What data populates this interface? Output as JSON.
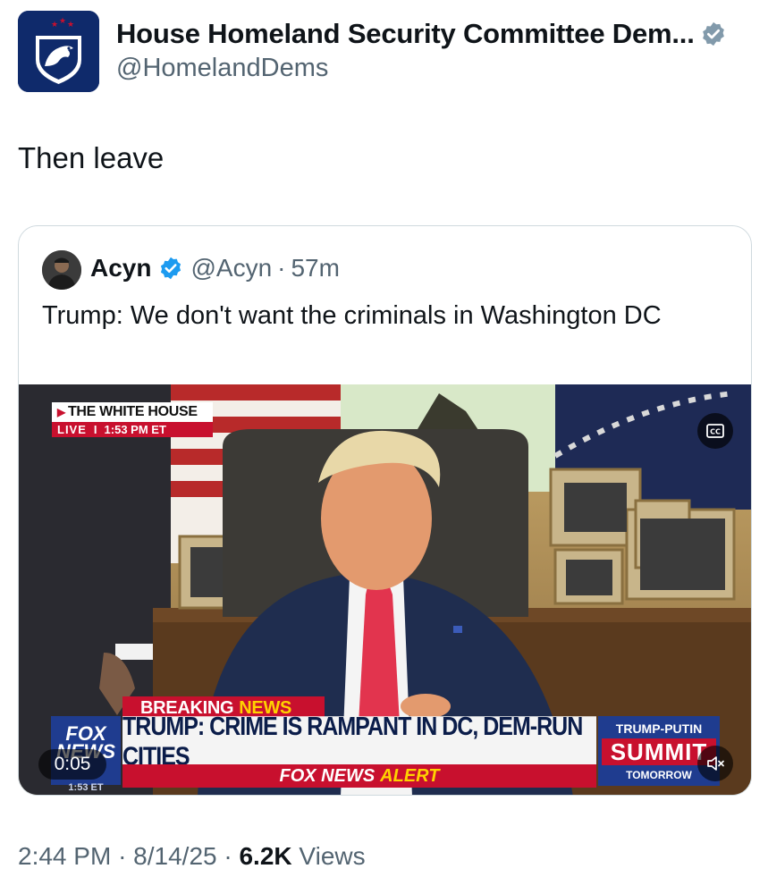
{
  "author": {
    "display_name": "House Homeland Security Committee Dem...",
    "handle": "@HomelandDems",
    "verified_badge": "gray-verified-icon",
    "avatar_icon": "eagle-shield-icon",
    "avatar_color": "#0f2a6b"
  },
  "tweet": {
    "text": "Then leave"
  },
  "quoted_tweet": {
    "display_name": "Acyn",
    "handle": "@Acyn",
    "separator": "·",
    "time_ago": "57m",
    "verified_badge": "blue-verified-icon",
    "text": "Trump: We don't want the criminals in Washington DC",
    "video": {
      "source_tag": "THE WHITE HOUSE",
      "live_label": "LIVE",
      "live_separator": "I",
      "live_time": "1:53 PM ET",
      "breaking_label": "BREAKING",
      "breaking_news": "NEWS",
      "fox_logo_line1": "FOX",
      "fox_logo_line2": "NEWS",
      "fox_logo_time": "1:53 ET",
      "headline": "TRUMP: CRIME IS RAMPANT IN DC, DEM-RUN CITIES",
      "alert_brand": "FOX NEWS",
      "alert_word": "ALERT",
      "promo_line1": "TRUMP-PUTIN",
      "promo_line2": "SUMMIT",
      "promo_line3": "TOMORROW",
      "timecode": "0:05",
      "cc_icon": "closed-captions-icon",
      "mute_icon": "speaker-muted-icon"
    }
  },
  "meta": {
    "time": "2:44 PM",
    "dot1": "·",
    "date": "8/14/25",
    "dot2": "·",
    "views_count": "6.2K",
    "views_label": "Views"
  },
  "colors": {
    "verified_blue": "#1d9bf0",
    "verified_gray": "#829aab",
    "secondary_text": "#536471",
    "fox_red": "#c8102e",
    "fox_blue": "#1f3c8f"
  }
}
